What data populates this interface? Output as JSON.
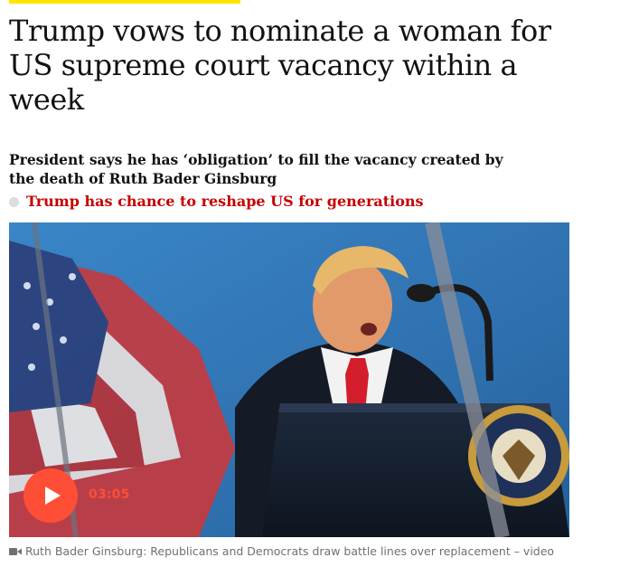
{
  "article": {
    "headline": "Trump vows to nominate a woman for US supreme court vacancy within a week",
    "standfirst": "President says he has ‘obligation’ to fill the vacancy created by the death of Ruth Bader Ginsburg",
    "related_link": "Trump has chance to reshape US for generations",
    "media": {
      "duration": "03:05",
      "caption": "Ruth Bader Ginsburg: Republicans and Democrats draw battle lines over replacement – video",
      "icons": {
        "play": "play-icon",
        "caption": "video-camera-icon",
        "bullet": "bullet-dot-icon"
      }
    }
  },
  "colors": {
    "accent_yellow": "#ffe500",
    "link_red": "#c70000",
    "play_orange": "#ff4e36",
    "caption_gray": "#707070",
    "sky_blue": "#2e74b7"
  }
}
